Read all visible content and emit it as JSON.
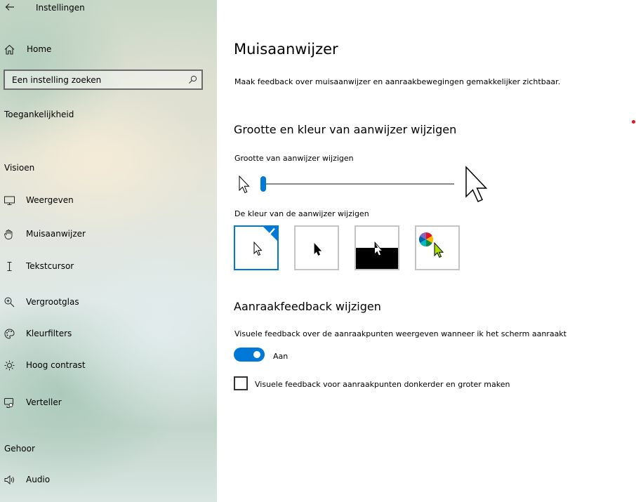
{
  "app": {
    "title": "Instellingen"
  },
  "sidebar": {
    "home_label": "Home",
    "search": {
      "placeholder": "Een instelling zoeken"
    },
    "category_title": "Toegankelijkheid",
    "sections": [
      {
        "title": "Visioen",
        "items": [
          {
            "label": "Weergeven",
            "icon": "monitor-icon"
          },
          {
            "label": "Muisaanwijzer",
            "icon": "mouse-pointer-icon"
          },
          {
            "label": "Tekstcursor",
            "icon": "text-cursor-icon"
          },
          {
            "label": "Vergrootglas",
            "icon": "magnifier-icon"
          },
          {
            "label": "Kleurfilters",
            "icon": "palette-icon"
          },
          {
            "label": "Hoog contrast",
            "icon": "contrast-sun-icon"
          },
          {
            "label": "Verteller",
            "icon": "narrator-icon"
          }
        ]
      },
      {
        "title": "Gehoor",
        "items": [
          {
            "label": "Audio",
            "icon": "speaker-icon"
          }
        ]
      }
    ]
  },
  "main": {
    "title": "Muisaanwijzer",
    "description": "Maak feedback over muisaanwijzer en aanraakbewegingen gemakkelijker zichtbaar.",
    "pointer_section": {
      "heading": "Grootte en kleur van aanwijzer wijzigen",
      "size_label": "Grootte van aanwijzer wijzigen",
      "size_value_fraction": 0.0,
      "color_label": "De kleur van de aanwijzer wijzigen",
      "color_options": [
        "white",
        "black",
        "inverted",
        "custom"
      ],
      "selected_color": "white"
    },
    "touch_section": {
      "heading": "Aanraakfeedback wijzigen",
      "visual_feedback_label": "Visuele feedback over de aanraakpunten weergeven wanneer ik het scherm aanraakt",
      "toggle_state": "Aan",
      "toggle_on": true,
      "darker_label": "Visuele feedback voor aanraakpunten donkerder en groter maken",
      "darker_checked": false
    }
  },
  "colors": {
    "accent": "#0078d7",
    "custom_pointer": "#a8e000",
    "notification_dot": "#e81123"
  }
}
